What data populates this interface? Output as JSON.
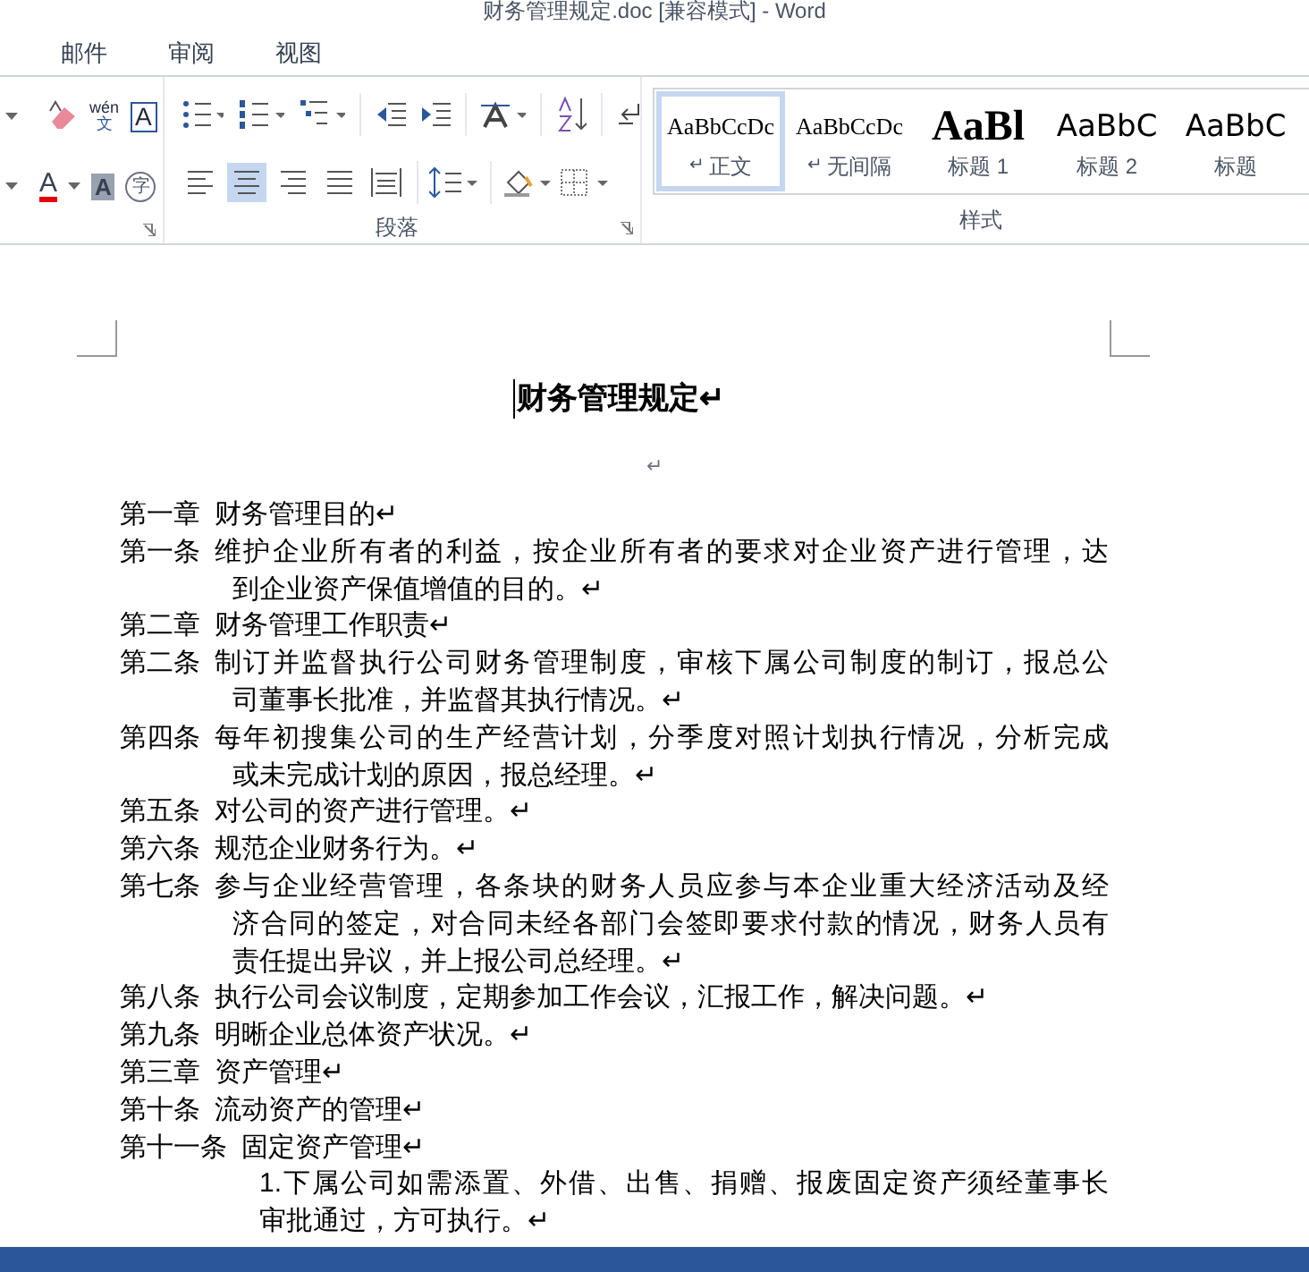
{
  "window": {
    "title": "财务管理规定.doc [兼容模式] - Word"
  },
  "tabs": [
    {
      "label": "邮件",
      "selected": false
    },
    {
      "label": "审阅",
      "selected": false
    },
    {
      "label": "视图",
      "selected": false
    }
  ],
  "ribbon": {
    "font_group": {
      "glyphs": [
        "wén",
        "文",
        "A",
        "A",
        "A",
        "字"
      ]
    },
    "paragraph_group": {
      "label": "段落",
      "align_buttons": [
        {
          "selected": false
        },
        {
          "selected": true
        },
        {
          "selected": false
        },
        {
          "selected": false
        },
        {
          "selected": false
        }
      ]
    },
    "styles_group": {
      "label": "样式",
      "styles": [
        {
          "preview": "AaBbCcDc",
          "kind": "serif",
          "marker": "↵",
          "name": "正文",
          "selected": true
        },
        {
          "preview": "AaBbCcDc",
          "kind": "serif",
          "marker": "↵",
          "name": "无间隔",
          "selected": false
        },
        {
          "preview": "AaBl",
          "kind": "heading",
          "name": "标题 1",
          "selected": false
        },
        {
          "preview": "AaBbC",
          "kind": "sans",
          "name": "标题 2",
          "selected": false
        },
        {
          "preview": "AaBbC",
          "kind": "sans",
          "name": "标题",
          "selected": false
        }
      ]
    }
  },
  "document": {
    "title": "财务管理规定↵",
    "empty_paragraph": "↵",
    "paragraphs": [
      {
        "kind": "article",
        "label": "第一章",
        "lines": [
          "财务管理目的↵"
        ]
      },
      {
        "kind": "article",
        "label": "第一条",
        "lines": [
          "维护企业所有者的利益，按企业所有者的要求对企业资产进行管理，达",
          "到企业资产保值增值的目的。↵"
        ]
      },
      {
        "kind": "article",
        "label": "第二章",
        "lines": [
          "财务管理工作职责↵"
        ]
      },
      {
        "kind": "article",
        "label": "第二条",
        "lines": [
          "制订并监督执行公司财务管理制度，审核下属公司制度的制订，报总公",
          "司董事长批准，并监督其执行情况。↵"
        ]
      },
      {
        "kind": "article",
        "label": "第四条",
        "lines": [
          "每年初搜集公司的生产经营计划，分季度对照计划执行情况，分析完成",
          "或未完成计划的原因，报总经理。↵"
        ]
      },
      {
        "kind": "article",
        "label": "第五条",
        "lines": [
          "对公司的资产进行管理。↵"
        ]
      },
      {
        "kind": "article",
        "label": "第六条",
        "lines": [
          "规范企业财务行为。↵"
        ]
      },
      {
        "kind": "article",
        "label": "第七条",
        "lines": [
          "参与企业经营管理，各条块的财务人员应参与本企业重大经济活动及经",
          "济合同的签定，对合同未经各部门会签即要求付款的情况，财务人员有",
          "责任提出异议，并上报公司总经理。↵"
        ]
      },
      {
        "kind": "article",
        "label": "第八条",
        "lines": [
          "执行公司会议制度，定期参加工作会议，汇报工作，解决问题。↵"
        ]
      },
      {
        "kind": "article",
        "label": "第九条",
        "lines": [
          "明晰企业总体资产状况。↵"
        ]
      },
      {
        "kind": "article",
        "label": "第三章",
        "lines": [
          "资产管理↵"
        ]
      },
      {
        "kind": "article",
        "label": "第十条",
        "lines": [
          "流动资产的管理↵"
        ]
      },
      {
        "kind": "article",
        "label": "第十一条",
        "lines": [
          "固定资产管理↵"
        ]
      },
      {
        "kind": "item",
        "lines": [
          "1.下属公司如需添置、外借、出售、捐赠、报废固定资产须经董事长",
          "审批通过，方可执行。↵"
        ]
      }
    ]
  }
}
